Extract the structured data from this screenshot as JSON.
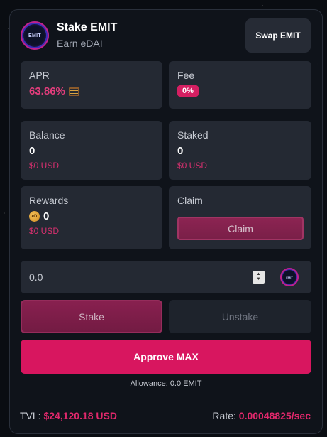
{
  "header": {
    "token_logo_text": "EMIT",
    "title": "Stake EMIT",
    "subtitle": "Earn eDAI",
    "swap_label": "Swap EMIT"
  },
  "stats": {
    "apr": {
      "label": "APR",
      "value": "63.86%",
      "icon": "abacus-icon"
    },
    "fee": {
      "label": "Fee",
      "value": "0%"
    },
    "balance": {
      "label": "Balance",
      "value": "0",
      "usd": "$0 USD"
    },
    "staked": {
      "label": "Staked",
      "value": "0",
      "usd": "$0 USD"
    },
    "rewards": {
      "label": "Rewards",
      "value": "0",
      "usd": "$0 USD",
      "token_icon": "edai-coin-icon",
      "coin_text": "eD"
    },
    "claim": {
      "label": "Claim",
      "button_label": "Claim"
    }
  },
  "amount": {
    "value": "0.0",
    "token_logo_text": "EMIT"
  },
  "tabs": {
    "stake": "Stake",
    "unstake": "Unstake"
  },
  "approve_label": "Approve MAX",
  "allowance": "Allowance: 0.0 EMIT",
  "footer": {
    "tvl_label": "TVL:",
    "tvl_value": "$24,120.18 USD",
    "rate_label": "Rate:",
    "rate_value": "0.00048825/sec"
  },
  "colors": {
    "accent": "#d8165f",
    "panel": "#242933",
    "card": "#10141b"
  }
}
